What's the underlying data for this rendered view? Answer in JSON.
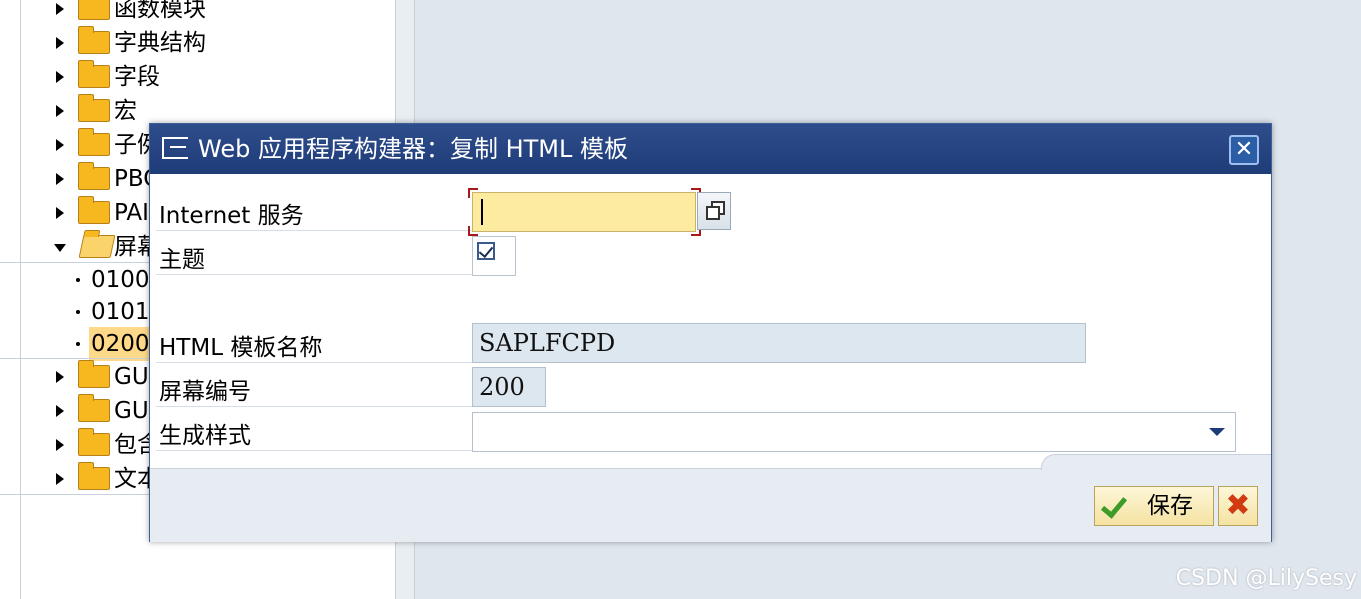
{
  "tree": {
    "items": [
      {
        "label": "函数模块",
        "type": "folder",
        "state": "collapsed"
      },
      {
        "label": "字典结构",
        "type": "folder",
        "state": "collapsed"
      },
      {
        "label": "字段",
        "type": "folder",
        "state": "collapsed"
      },
      {
        "label": "宏",
        "type": "folder",
        "state": "collapsed"
      },
      {
        "label": "子例",
        "type": "folder",
        "state": "collapsed"
      },
      {
        "label": "PBO",
        "type": "folder",
        "state": "collapsed"
      },
      {
        "label": "PAI",
        "type": "folder",
        "state": "collapsed"
      },
      {
        "label": "屏幕",
        "type": "folder",
        "state": "expanded"
      },
      {
        "label": "0100",
        "type": "leaf"
      },
      {
        "label": "0101",
        "type": "leaf"
      },
      {
        "label": "0200",
        "type": "leaf",
        "selected": true
      },
      {
        "label": "GUI",
        "type": "folder",
        "state": "collapsed"
      },
      {
        "label": "GUI",
        "type": "folder",
        "state": "collapsed"
      },
      {
        "label": "包含",
        "type": "folder",
        "state": "collapsed"
      },
      {
        "label": "文本",
        "type": "folder",
        "state": "collapsed"
      }
    ]
  },
  "dialog": {
    "title": "Web 应用程序构建器：复制 HTML 模板",
    "close_symbol": "✕",
    "fields": {
      "internet_service": {
        "label": "Internet 服务",
        "value": ""
      },
      "theme": {
        "label": "主题",
        "checked": true
      },
      "template_name": {
        "label": "HTML 模板名称",
        "value": "SAPLFCPD"
      },
      "screen_number": {
        "label": "屏幕编号",
        "value": "200"
      },
      "generation_style": {
        "label": "生成样式",
        "value": ""
      }
    },
    "buttons": {
      "save_label": "保存",
      "cancel_symbol": "✖"
    }
  },
  "colors": {
    "title_bar": "#1e3c78",
    "focus_input": "#fdeba0",
    "readonly_field": "#dde7f0",
    "folder": "#f7b71e",
    "save_check": "#3d9b27",
    "cancel_x": "#d23b12"
  },
  "watermark": "CSDN @LilySesy"
}
